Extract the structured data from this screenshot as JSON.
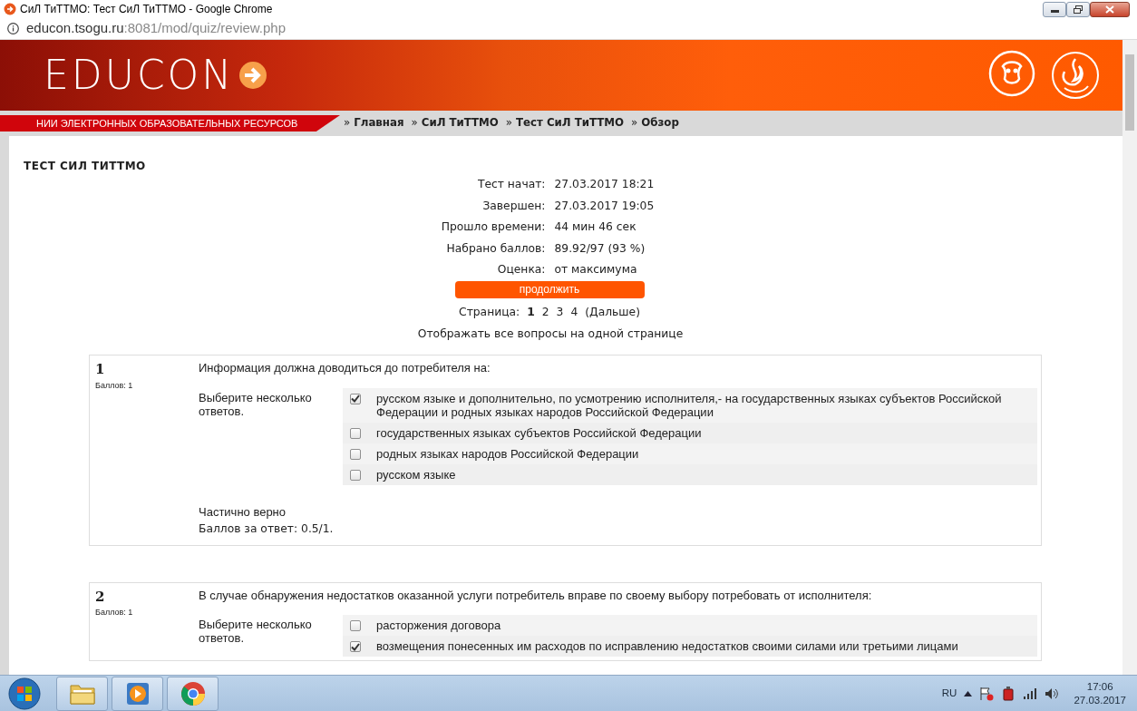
{
  "window": {
    "title": "СиЛ ТиТТМО: Тест СиЛ ТиТТМО - Google Chrome"
  },
  "address_bar": {
    "host": "educon.tsogu.ru",
    "path": ":8081/mod/quiz/review.php"
  },
  "banner": {
    "logo": "EDUCON",
    "tagline": "НИИ ЭЛЕКТРОННЫХ ОБРАЗОВАТЕЛЬНЫХ РЕСУРСОВ"
  },
  "breadcrumbs": [
    {
      "text": "Главная"
    },
    {
      "text": "СиЛ ТиТТМО"
    },
    {
      "text": "Тест СиЛ ТиТТМО"
    },
    {
      "text": "Обзор"
    }
  ],
  "breadcrumb_separator": "»",
  "quiz_title": "ТЕСТ СИЛ ТИТТМО",
  "summary": [
    {
      "label": "Тест начат:",
      "value": "27.03.2017 18:21"
    },
    {
      "label": "Завершен:",
      "value": "27.03.2017 19:05"
    },
    {
      "label": "Прошло времени:",
      "value": "44 мин 46 сек"
    },
    {
      "label": "Набрано баллов:",
      "value": "89.92/97 (93 %)"
    },
    {
      "label": "Оценка:",
      "value": "от максимума"
    }
  ],
  "continue_button": "продолжить",
  "pagination": {
    "label": "Страница:",
    "pages": [
      {
        "text": "1",
        "selected": true
      },
      {
        "text": "2",
        "selected": false
      },
      {
        "text": "3",
        "selected": false
      },
      {
        "text": "4",
        "selected": false
      }
    ],
    "next": "(Дальше)"
  },
  "show_all_link": "Отображать все вопросы на одной странице",
  "questions": [
    {
      "number": "1",
      "marks": "Баллов: 1",
      "text": "Информация должна доводиться до потребителя на:",
      "instruction": "Выберите несколько ответов.",
      "options": [
        {
          "text": "русском языке и дополнительно, по усмотрению исполнителя,- на государственных языках субъектов Российской Федерации и родных языках народов Российской Федерации",
          "checked": true
        },
        {
          "text": "государственных языках субъектов Российской Федерации",
          "checked": false
        },
        {
          "text": "родных языках народов Российской Федерации",
          "checked": false
        },
        {
          "text": "русском языке",
          "checked": false
        }
      ],
      "feedback": {
        "state": "Частично верно",
        "grade": "Баллов за ответ: 0.5/1."
      }
    },
    {
      "number": "2",
      "marks": "Баллов: 1",
      "text": "В случае обнаружения недостатков оказанной услуги потребитель вправе по своему выбору потребовать от исполнителя:",
      "instruction": "Выберите несколько ответов.",
      "options": [
        {
          "text": "расторжения договора",
          "checked": false
        },
        {
          "text": "возмещения понесенных им расходов по исправлению недостатков своими силами или третьими лицами",
          "checked": true
        }
      ]
    }
  ],
  "taskbar": {
    "apps": [
      {
        "kind": "folder"
      },
      {
        "kind": "media"
      },
      {
        "kind": "chrome"
      }
    ],
    "language": "RU",
    "time": "17:06",
    "date": "27.03.2017"
  }
}
